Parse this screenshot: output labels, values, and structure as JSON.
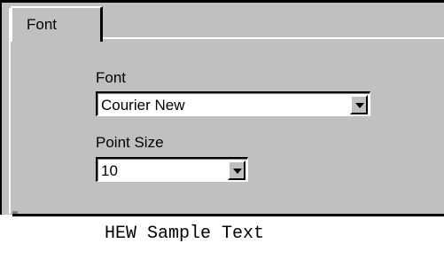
{
  "tabs": [
    {
      "label": "Font"
    }
  ],
  "font_section": {
    "font_label": "Font",
    "font_value": "Courier New",
    "size_label": "Point Size",
    "size_value": "10"
  },
  "preview": {
    "sample_text": "HEW Sample Text"
  },
  "icons": {
    "font_dropdown": "chevron-down-icon",
    "size_dropdown": "chevron-down-icon"
  },
  "colors": {
    "dialog_background": "#c0c0c0",
    "preview_background": "#ffffff"
  }
}
